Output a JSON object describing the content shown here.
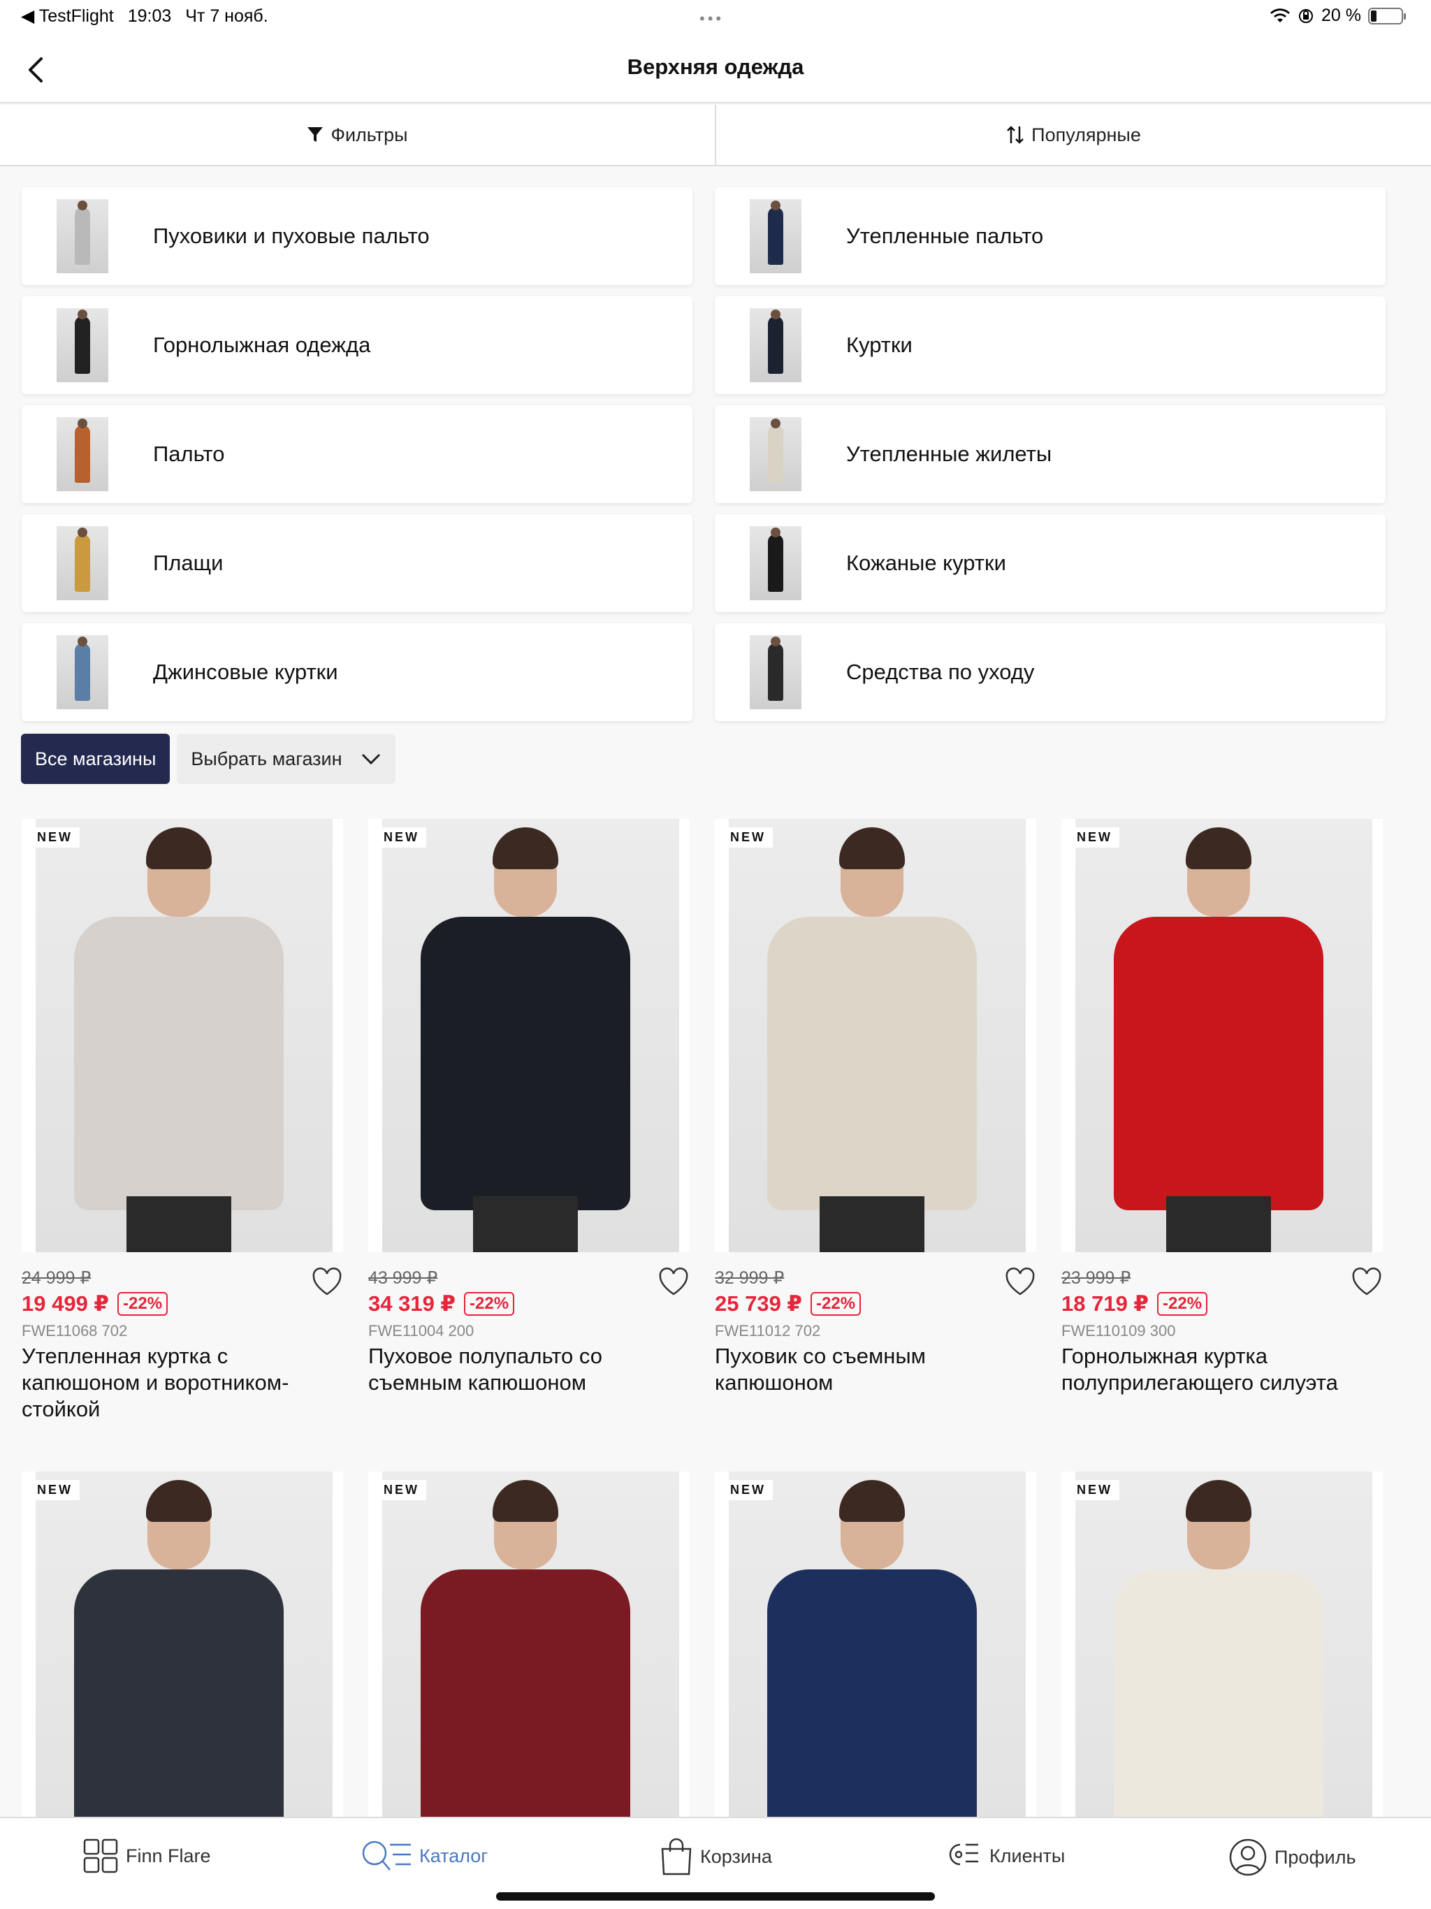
{
  "status_bar": {
    "app": "◀ TestFlight",
    "time": "19:03",
    "date": "Чт 7 нояб.",
    "battery": "20 %",
    "battery_level": 0.2
  },
  "nav": {
    "title": "Верхняя одежда"
  },
  "filter_bar": {
    "filters_label": "Фильтры",
    "sort_label": "Популярные"
  },
  "categories": [
    {
      "label": "Пуховики и пуховые пальто",
      "color": "#b9b9b9"
    },
    {
      "label": "Утепленные пальто",
      "color": "#1f2b4a"
    },
    {
      "label": "Горнолыжная одежда",
      "color": "#222222"
    },
    {
      "label": "Куртки",
      "color": "#1c2330"
    },
    {
      "label": "Пальто",
      "color": "#b8612e"
    },
    {
      "label": "Утепленные жилеты",
      "color": "#d8d3c4"
    },
    {
      "label": "Плащи",
      "color": "#c99a3e"
    },
    {
      "label": "Кожаные куртки",
      "color": "#1a1a1a"
    },
    {
      "label": "Джинсовые куртки",
      "color": "#5a7ea6"
    },
    {
      "label": "Средства по уходу",
      "color": "#2a2a2a"
    }
  ],
  "stores": {
    "all_label": "Все магазины",
    "select_label": "Выбрать магазин"
  },
  "products": [
    {
      "badge": "NEW",
      "old_price": "24 999 ₽",
      "price": "19 499 ₽",
      "discount": "-22%",
      "sku": "FWE11068 702",
      "name": "Утепленная куртка с капюшоном и воротником-стойкой",
      "color": "#d6d1cd"
    },
    {
      "badge": "NEW",
      "old_price": "43 999 ₽",
      "price": "34 319 ₽",
      "discount": "-22%",
      "sku": "FWE11004 200",
      "name": "Пуховое полупальто со съемным капюшоном",
      "color": "#1b1e24"
    },
    {
      "badge": "NEW",
      "old_price": "32 999 ₽",
      "price": "25 739 ₽",
      "discount": "-22%",
      "sku": "FWE11012 702",
      "name": "Пуховик со съемным капюшоном",
      "color": "#ddd6c8"
    },
    {
      "badge": "NEW",
      "old_price": "23 999 ₽",
      "price": "18 719 ₽",
      "discount": "-22%",
      "sku": "FWE110109 300",
      "name": "Горнолыжная куртка полуприлегающего силуэта",
      "color": "#c8161c"
    },
    {
      "badge": "NEW",
      "old_price": "",
      "price": "",
      "discount": "",
      "sku": "",
      "name": "",
      "color": "#2e323d"
    },
    {
      "badge": "NEW",
      "old_price": "",
      "price": "",
      "discount": "",
      "sku": "",
      "name": "",
      "color": "#7a1a22"
    },
    {
      "badge": "NEW",
      "old_price": "",
      "price": "",
      "discount": "",
      "sku": "",
      "name": "",
      "color": "#1d2f5c"
    },
    {
      "badge": "NEW",
      "old_price": "",
      "price": "",
      "discount": "",
      "sku": "",
      "name": "",
      "color": "#ede8de"
    }
  ],
  "tabs": [
    {
      "label": "Finn Flare",
      "icon": "grid-icon"
    },
    {
      "label": "Каталог",
      "icon": "catalog-search-icon"
    },
    {
      "label": "Корзина",
      "icon": "bag-icon"
    },
    {
      "label": "Клиенты",
      "icon": "clients-icon"
    },
    {
      "label": "Профиль",
      "icon": "profile-icon"
    }
  ],
  "accent_color": "#24294f",
  "sale_color": "#e5253a",
  "active_tab_color": "#4a78c2"
}
